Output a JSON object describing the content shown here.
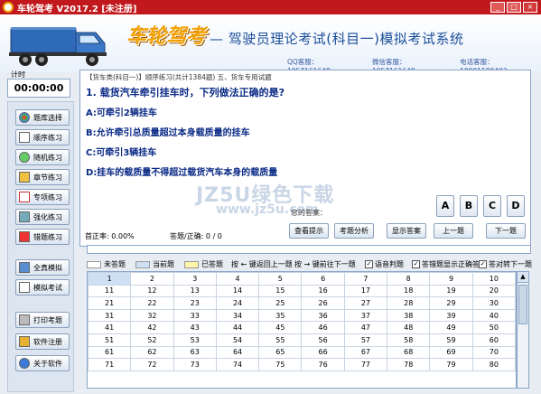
{
  "window": {
    "title": "车轮驾考 V2017.2 [未注册]",
    "min_label": "_",
    "max_label": "□",
    "close_label": "×"
  },
  "banner": {
    "logo": "车轮驾考",
    "subtitle": "— 驾驶员理论考试(科目一)模拟考试系统",
    "qq": "QQ客服：1057161648",
    "wechat": "微信客服：1057161648",
    "phone": "电话客服：18901588403"
  },
  "timer": {
    "label": "计时",
    "value": "00:00:00"
  },
  "nav": [
    {
      "label": "题库选择",
      "icon": "books-icon"
    },
    {
      "label": "顺序练习",
      "icon": "list-icon"
    },
    {
      "label": "随机练习",
      "icon": "shuffle-icon"
    },
    {
      "label": "章节练习",
      "icon": "folder-icon"
    },
    {
      "label": "专项练习",
      "icon": "target-icon"
    },
    {
      "label": "强化练习",
      "icon": "chart-icon"
    },
    {
      "label": "错题练习",
      "icon": "flag-icon"
    },
    {
      "label": "全真模拟",
      "icon": "monitor-icon"
    },
    {
      "label": "模拟考试",
      "icon": "exam-icon"
    },
    {
      "label": "打印考题",
      "icon": "printer-icon"
    },
    {
      "label": "软件注册",
      "icon": "key-icon"
    },
    {
      "label": "关于软件",
      "icon": "info-icon"
    }
  ],
  "question": {
    "header": "【货车类(科目一)】顺序练习(共计1384题) 五、货车专用试题",
    "text": "1. 载货汽车牵引挂车时，下列做法正确的是?",
    "options": [
      "A:可牵引2辆挂车",
      "B:允许牵引总质量超过本身载质量的挂车",
      "C:可牵引3辆挂车",
      "D:挂车的载质量不得超过载货汽车本身的载质量"
    ],
    "answer_label": "您的答案："
  },
  "watermark": {
    "main": "JZ5U绿色下载",
    "url": "www.jz5u.com"
  },
  "answer_buttons": [
    "A",
    "B",
    "C",
    "D"
  ],
  "stats": {
    "accuracy": "首正率: 0.00%",
    "answered": "答题/正确: 0 / 0"
  },
  "actions": [
    "查看提示",
    "考题分析",
    "显示答案",
    "上一题",
    "下一题"
  ],
  "progress": {
    "fraction": 0.0
  },
  "legend": {
    "unanswered": "未答题",
    "current": "当前题",
    "answered": "已答题",
    "prev_hint": "按 ← 键返回上一题",
    "next_hint": "按 → 键前往下一题",
    "voice": "语音判题",
    "show_error": "答错题显示正确答案",
    "auto_next": "答对转下一题"
  },
  "grid": {
    "rows": [
      [
        "1",
        "2",
        "3",
        "4",
        "5",
        "6",
        "7",
        "8",
        "9",
        "10"
      ],
      [
        "11",
        "12",
        "13",
        "14",
        "15",
        "16",
        "17",
        "18",
        "19",
        "20"
      ],
      [
        "21",
        "22",
        "23",
        "24",
        "25",
        "26",
        "27",
        "28",
        "29",
        "30"
      ],
      [
        "31",
        "32",
        "33",
        "34",
        "35",
        "36",
        "37",
        "38",
        "39",
        "40"
      ],
      [
        "41",
        "42",
        "43",
        "44",
        "45",
        "46",
        "47",
        "48",
        "49",
        "50"
      ],
      [
        "51",
        "52",
        "53",
        "54",
        "55",
        "56",
        "57",
        "58",
        "59",
        "60"
      ],
      [
        "61",
        "62",
        "63",
        "64",
        "65",
        "66",
        "67",
        "68",
        "69",
        "70"
      ],
      [
        "71",
        "72",
        "73",
        "74",
        "75",
        "76",
        "77",
        "78",
        "79",
        "80"
      ]
    ]
  },
  "colors": {
    "titlebar": "#c0181c",
    "unanswered": "#ffffff",
    "current": "#cfe0f5",
    "answered": "#fff4a8"
  }
}
